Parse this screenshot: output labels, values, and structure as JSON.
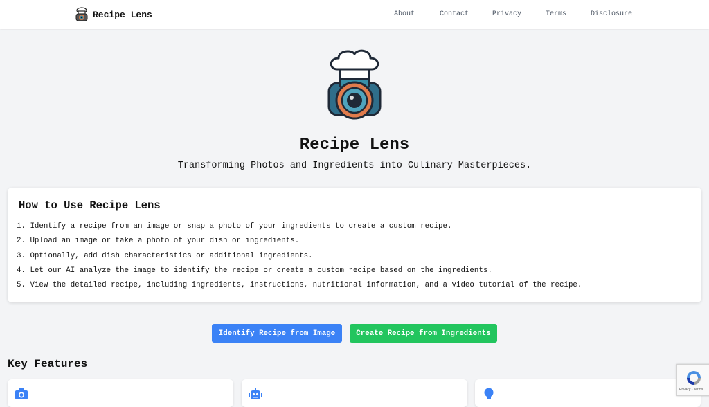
{
  "header": {
    "brand_name": "Recipe Lens",
    "nav": [
      "About",
      "Contact",
      "Privacy",
      "Terms",
      "Disclosure"
    ]
  },
  "hero": {
    "title": "Recipe Lens",
    "subtitle": "Transforming Photos and Ingredients into Culinary Masterpieces."
  },
  "howto": {
    "title": "How to Use Recipe Lens",
    "steps": [
      "1. Identify a recipe from an image or snap a photo of your ingredients to create a custom recipe.",
      "2. Upload an image or take a photo of your dish or ingredients.",
      "3. Optionally, add dish characteristics or additional ingredients.",
      "4. Let our AI analyze the image to identify the recipe or create a custom recipe based on the ingredients.",
      "5. View the detailed recipe, including ingredients, instructions, nutritional information, and a video tutorial of the recipe."
    ]
  },
  "actions": {
    "identify_label": "Identify Recipe from Image",
    "create_label": "Create Recipe from Ingredients"
  },
  "features": {
    "title": "Key Features",
    "icons": [
      "camera-icon",
      "robot-icon",
      "lightbulb-icon"
    ]
  },
  "recaptcha": {
    "text": "Privacy - Terms"
  },
  "colors": {
    "primary_blue": "#3b82f6",
    "primary_green": "#22c55e",
    "background": "#f3f4f6"
  }
}
